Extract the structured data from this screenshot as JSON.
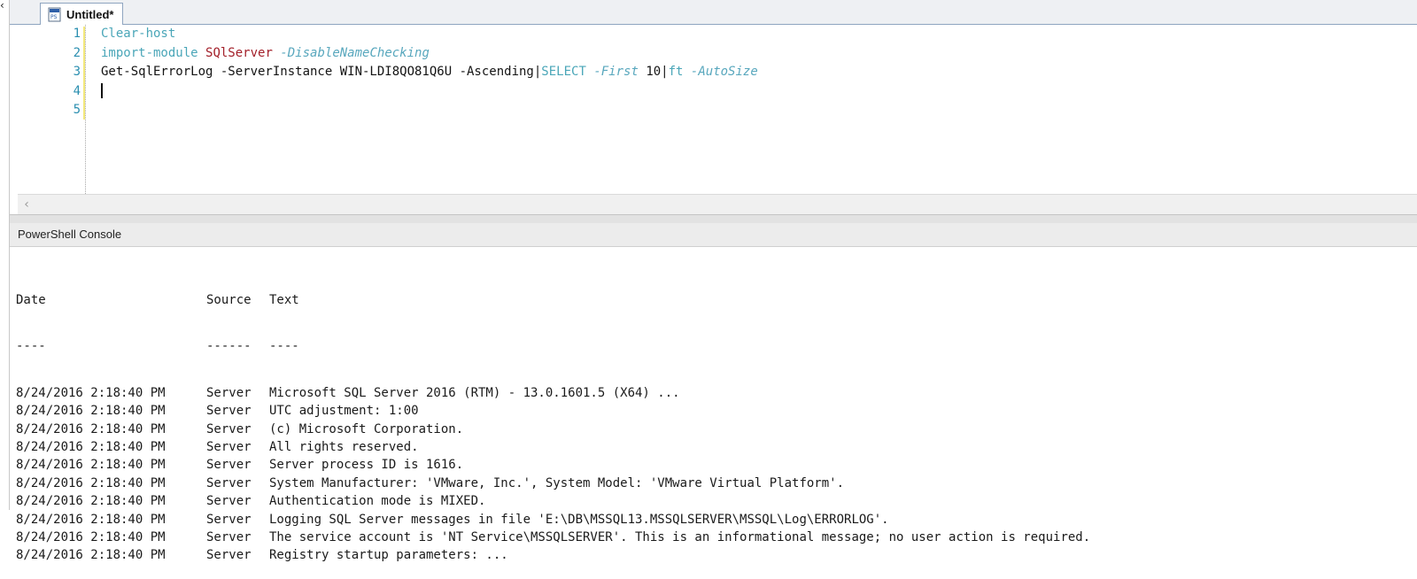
{
  "tab": {
    "label": "Untitled*",
    "icon": "powershell-script-file-icon"
  },
  "editor": {
    "line_numbers": [
      "1",
      "2",
      "3",
      "4",
      "5"
    ],
    "lines": [
      [
        {
          "text": "Clear-host",
          "kind": "cmd"
        }
      ],
      [
        {
          "text": "import-module ",
          "kind": "cmd"
        },
        {
          "text": "SQlServer",
          "kind": "type"
        },
        {
          "text": " ",
          "kind": "plain"
        },
        {
          "text": "-DisableNameChecking",
          "kind": "param"
        }
      ],
      [
        {
          "text": "Get-SqlErrorLog -ServerInstance WIN-LDI8QO81Q6U -Ascending|",
          "kind": "plain"
        },
        {
          "text": "SELECT",
          "kind": "cmd"
        },
        {
          "text": " ",
          "kind": "plain"
        },
        {
          "text": "-First",
          "kind": "param"
        },
        {
          "text": " 10|",
          "kind": "plain"
        },
        {
          "text": "ft",
          "kind": "cmd"
        },
        {
          "text": " ",
          "kind": "plain"
        },
        {
          "text": "-AutoSize",
          "kind": "param"
        }
      ],
      [],
      []
    ],
    "colors": {
      "cmd": "#4aa6b8",
      "type": "#a3202a",
      "param": "#58a7bd",
      "plain": "#141414",
      "line_number": "#2b8fb0"
    }
  },
  "scrollbar": {
    "left_arrow": "‹"
  },
  "console": {
    "title": "PowerShell Console",
    "headers": [
      "Date",
      "Source",
      "Text"
    ],
    "underlines": [
      "----",
      "------",
      "----"
    ],
    "rows": [
      {
        "date": "8/24/2016 2:18:40 PM",
        "source": "Server",
        "text": "Microsoft SQL Server 2016 (RTM) - 13.0.1601.5 (X64) ..."
      },
      {
        "date": "8/24/2016 2:18:40 PM",
        "source": "Server",
        "text": "UTC adjustment: 1:00"
      },
      {
        "date": "8/24/2016 2:18:40 PM",
        "source": "Server",
        "text": "(c) Microsoft Corporation."
      },
      {
        "date": "8/24/2016 2:18:40 PM",
        "source": "Server",
        "text": "All rights reserved."
      },
      {
        "date": "8/24/2016 2:18:40 PM",
        "source": "Server",
        "text": "Server process ID is 1616."
      },
      {
        "date": "8/24/2016 2:18:40 PM",
        "source": "Server",
        "text": "System Manufacturer: 'VMware, Inc.', System Model: 'VMware Virtual Platform'."
      },
      {
        "date": "8/24/2016 2:18:40 PM",
        "source": "Server",
        "text": "Authentication mode is MIXED."
      },
      {
        "date": "8/24/2016 2:18:40 PM",
        "source": "Server",
        "text": "Logging SQL Server messages in file 'E:\\DB\\MSSQL13.MSSQLSERVER\\MSSQL\\Log\\ERRORLOG'."
      },
      {
        "date": "8/24/2016 2:18:40 PM",
        "source": "Server",
        "text": "The service account is 'NT Service\\MSSQLSERVER'. This is an informational message; no user action is required."
      },
      {
        "date": "8/24/2016 2:18:40 PM",
        "source": "Server",
        "text": "Registry startup parameters: ..."
      }
    ]
  }
}
